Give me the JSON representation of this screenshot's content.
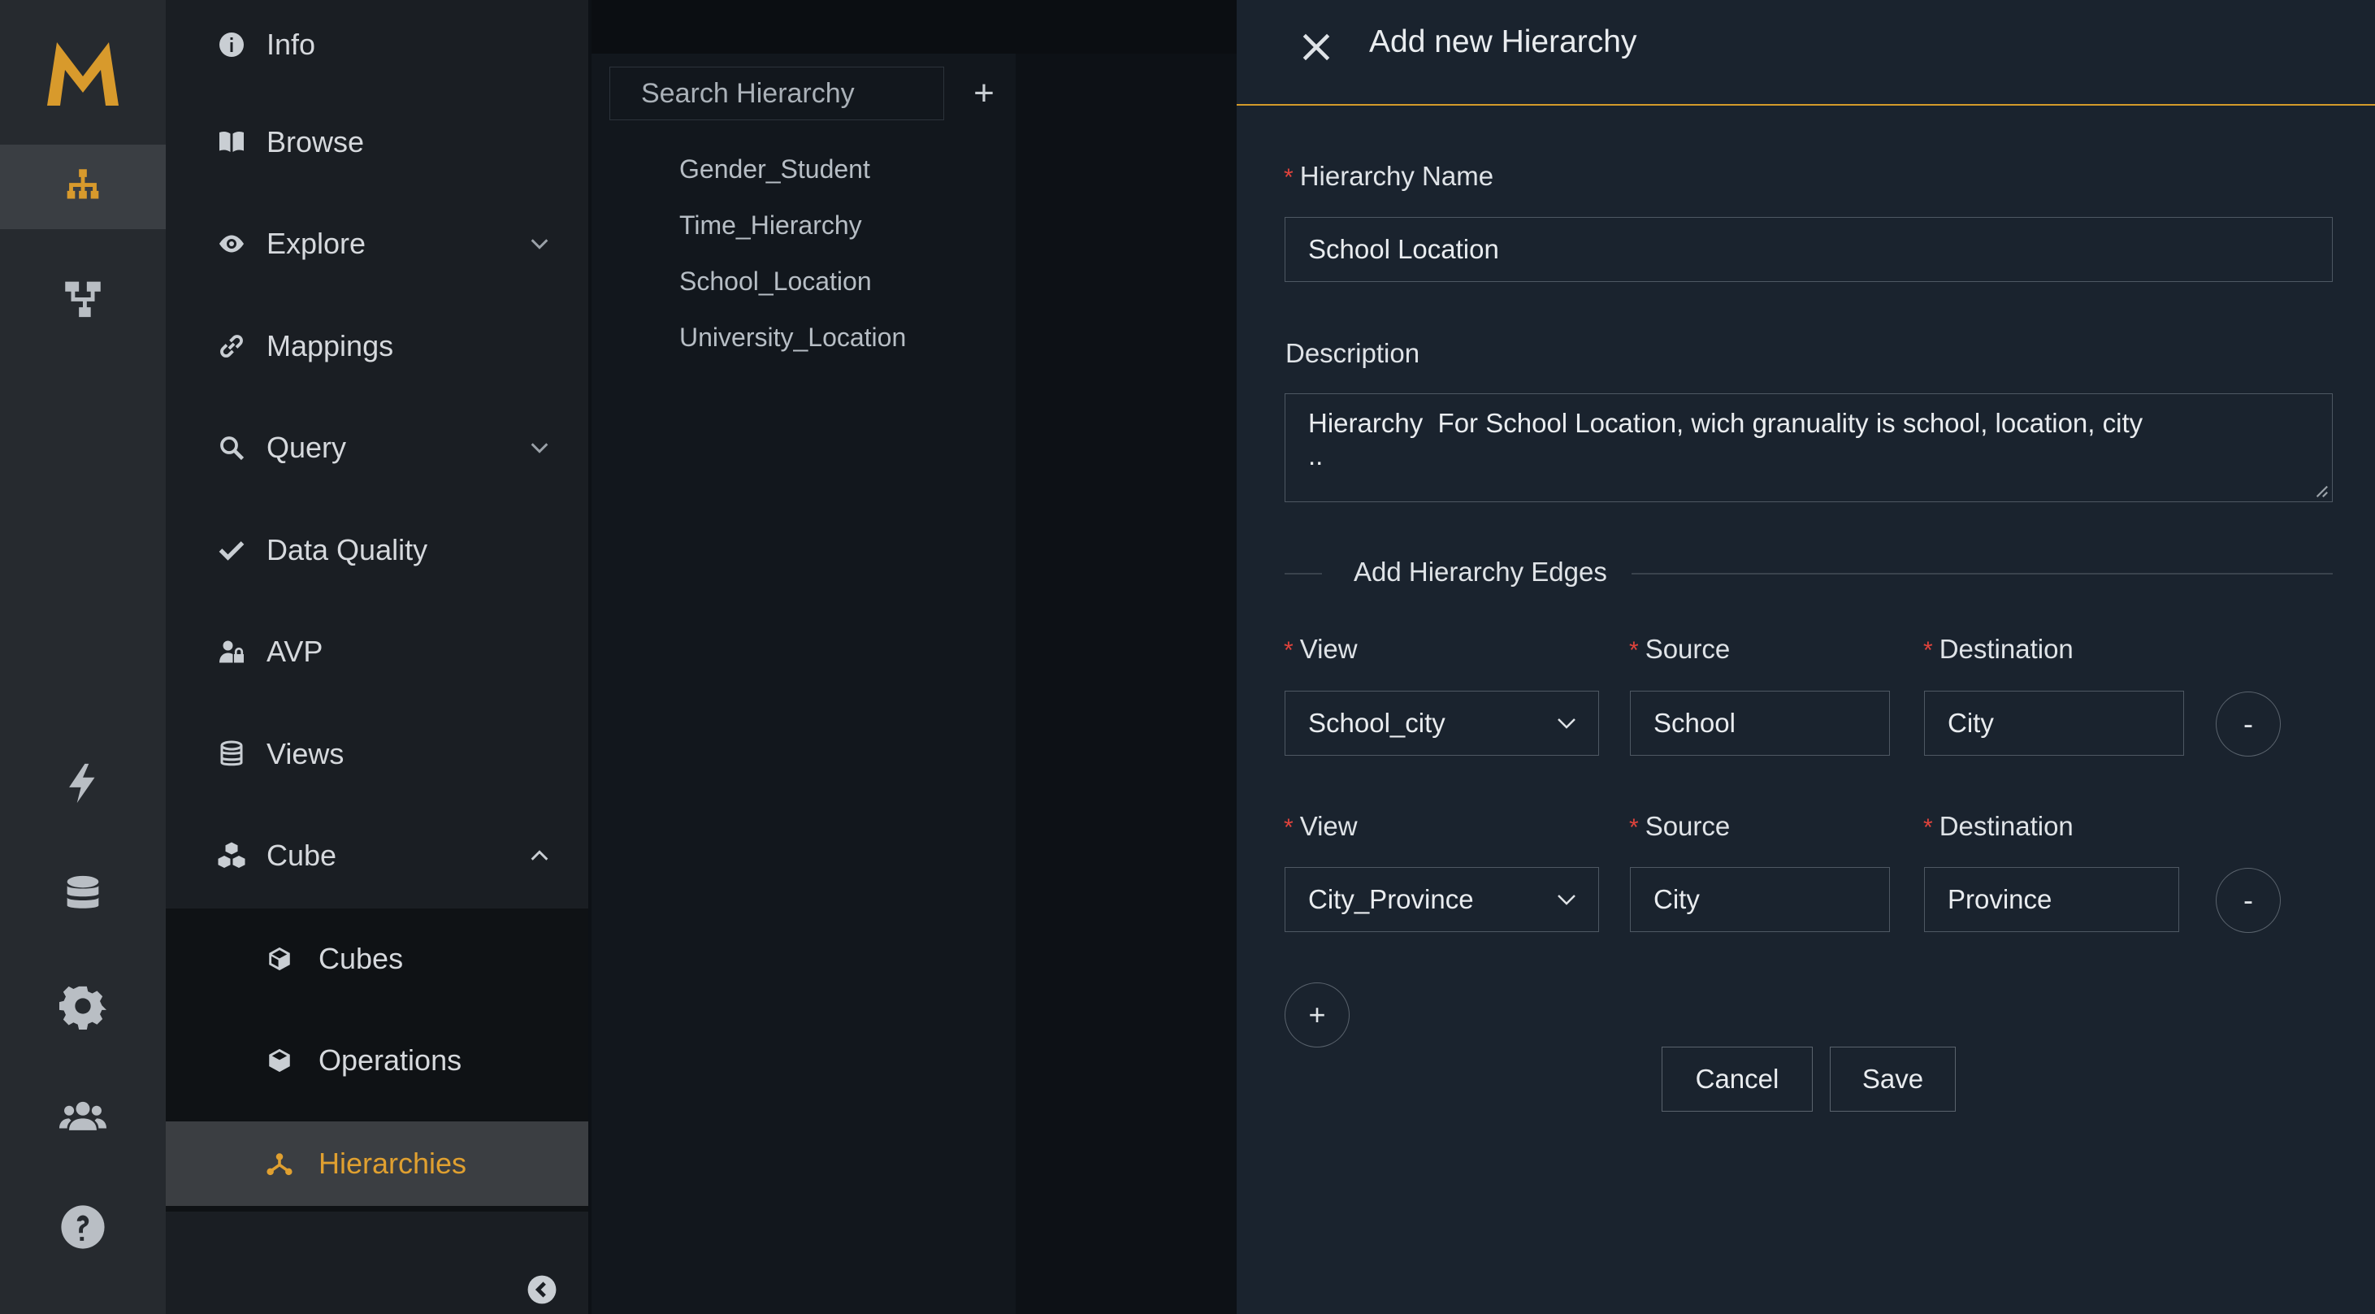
{
  "colors": {
    "accent": "#e0a030",
    "required": "#e0433c",
    "drawer_bg": "#1a232e"
  },
  "rail": {
    "logo": "M",
    "items": [
      {
        "icon": "hierarchy-icon",
        "active": true
      },
      {
        "icon": "tree-diagram-icon",
        "active": false
      },
      {
        "icon": "lightning-icon",
        "active": false
      },
      {
        "icon": "database-icon",
        "active": false
      },
      {
        "icon": "gear-icon",
        "active": false
      },
      {
        "icon": "users-icon",
        "active": false
      },
      {
        "icon": "help-icon",
        "active": false
      }
    ]
  },
  "nav": {
    "items": [
      {
        "label": "Info",
        "icon": "info-icon"
      },
      {
        "label": "Browse",
        "icon": "book-icon"
      },
      {
        "label": "Explore",
        "icon": "eye-icon"
      },
      {
        "label": "Mappings",
        "icon": "link-icon"
      },
      {
        "label": "Query",
        "icon": "magnifier-icon"
      },
      {
        "label": "Data Quality",
        "icon": "check-icon"
      },
      {
        "label": "AVP",
        "icon": "user-lock-icon"
      },
      {
        "label": "Views",
        "icon": "layers-icon"
      },
      {
        "label": "Cube",
        "icon": "cubes-icon"
      }
    ],
    "sub_items": [
      {
        "label": "Cubes",
        "icon": "cube-icon"
      },
      {
        "label": "Operations",
        "icon": "box-icon"
      },
      {
        "label": "Hierarchies",
        "icon": "hierarchy-node-icon",
        "active": true
      }
    ]
  },
  "list": {
    "search_placeholder": "Search Hierarchy",
    "add_symbol": "+",
    "items": [
      "Gender_Student",
      "Time_Hierarchy",
      "School_Location",
      "University_Location"
    ]
  },
  "drawer": {
    "title": "Add new Hierarchy",
    "name_label": "Hierarchy Name",
    "name_value": "School Location",
    "description_label": "Description",
    "description_value": "Hierarchy  For School Location, wich granuality is school, location, city\n..",
    "edges_title": "Add Hierarchy Edges",
    "required_mark": "*",
    "view_label": "View",
    "source_label": "Source",
    "destination_label": "Destination",
    "edges": [
      {
        "view": "School_city",
        "source": "School",
        "destination": "City"
      },
      {
        "view": "City_Province",
        "source": "City",
        "destination": "Province"
      }
    ],
    "remove_symbol": "-",
    "add_symbol": "+",
    "cancel_label": "Cancel",
    "save_label": "Save"
  }
}
